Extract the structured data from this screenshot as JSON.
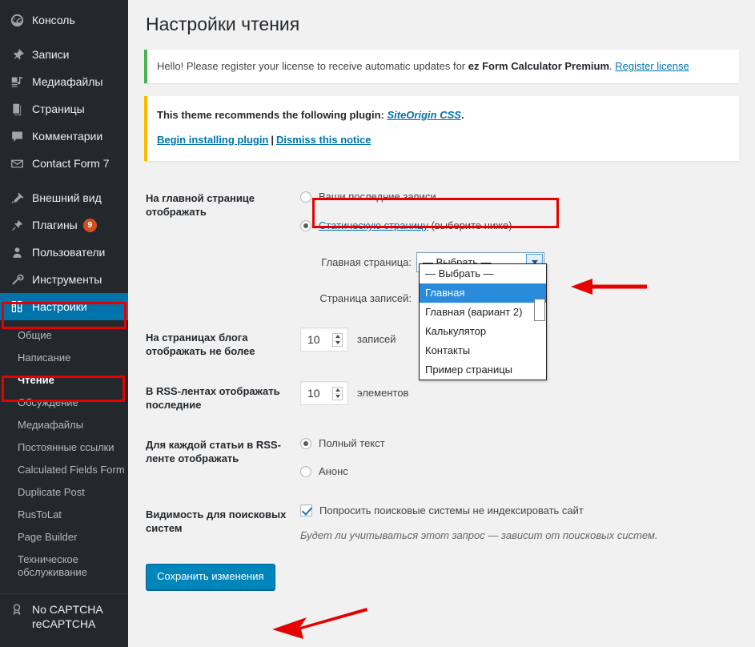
{
  "sidebar": {
    "primary": [
      {
        "label": "Консоль",
        "icon": "dashboard-icon"
      },
      {
        "label": "Записи",
        "icon": "pin-icon"
      },
      {
        "label": "Медиафайлы",
        "icon": "media-icon"
      },
      {
        "label": "Страницы",
        "icon": "pages-icon"
      },
      {
        "label": "Комментарии",
        "icon": "comments-icon"
      },
      {
        "label": "Contact Form 7",
        "icon": "envelope-icon"
      },
      {
        "label": "Внешний вид",
        "icon": "appearance-icon"
      },
      {
        "label": "Плагины",
        "icon": "plugins-icon",
        "badge": "9"
      },
      {
        "label": "Пользователи",
        "icon": "users-icon"
      },
      {
        "label": "Инструменты",
        "icon": "tools-icon"
      },
      {
        "label": "Настройки",
        "icon": "settings-icon",
        "current": true
      }
    ],
    "submenu": [
      {
        "label": "Общие"
      },
      {
        "label": "Написание"
      },
      {
        "label": "Чтение",
        "current": true
      },
      {
        "label": "Обсуждение"
      },
      {
        "label": "Медиафайлы"
      },
      {
        "label": "Постоянные ссылки"
      },
      {
        "label": "Calculated Fields Form"
      },
      {
        "label": "Duplicate Post"
      },
      {
        "label": "RusToLat"
      },
      {
        "label": "Page Builder"
      },
      {
        "label": "Техническое обслуживание"
      }
    ],
    "bottom": {
      "label": "No CAPTCHA reCAPTCHA",
      "icon": "captcha-icon"
    }
  },
  "page": {
    "title": "Настройки чтения"
  },
  "notices": {
    "license": {
      "text_before": "Hello! Please register your license to receive automatic updates for ",
      "bold": "ez Form Calculator Premium",
      "text_after": ". ",
      "link": "Register license",
      "accent_color": "#46b450"
    },
    "plugin": {
      "line1_before": "This theme recommends the following plugin: ",
      "line1_link": "SiteOrigin CSS",
      "line1_after": ".",
      "install_link": "Begin installing plugin",
      "separator": "|",
      "dismiss_link": "Dismiss this notice",
      "accent_color": "#ffb900"
    }
  },
  "form": {
    "front_page": {
      "label": "На главной странице отображать",
      "option_posts": "Ваши последние записи",
      "option_static_link": "Статическую страницу",
      "option_static_suffix": " (выберите ниже)",
      "selected": "static",
      "homepage_label": "Главная страница:",
      "homepage_value": "— Выбрать —",
      "posts_page_label": "Страница записей:",
      "dropdown_open": true,
      "dropdown_options": [
        "— Выбрать —",
        "Главная",
        "Главная (вариант 2)",
        "Калькулятор",
        "Контакты",
        "Пример страницы"
      ],
      "dropdown_highlighted": "Главная"
    },
    "posts_per_page": {
      "label": "На страницах блога отображать не более",
      "value": "10",
      "suffix": "записей"
    },
    "rss_items": {
      "label": "В RSS-лентах отображать последние",
      "value": "10",
      "suffix": "элементов"
    },
    "rss_excerpt": {
      "label": "Для каждой статьи в RSS-ленте отображать",
      "option_full": "Полный текст",
      "option_summary": "Анонс",
      "selected": "full"
    },
    "search_visibility": {
      "label": "Видимость для поисковых систем",
      "checkbox_label": "Попросить поисковые системы не индексировать сайт",
      "checked": true,
      "hint": "Будет ли учитываться этот запрос — зависит от поисковых систем."
    },
    "submit": {
      "label": "Сохранить изменения"
    }
  },
  "annotations": {
    "color": "#e60000",
    "box_settings_menu": "highlight-settings-menu",
    "box_reading_submenu": "highlight-reading-submenu",
    "box_static_radio": "highlight-static-page-radio",
    "arrow_dropdown": "arrow-pointing-to-selected-option",
    "arrow_save": "arrow-pointing-to-save-button"
  }
}
